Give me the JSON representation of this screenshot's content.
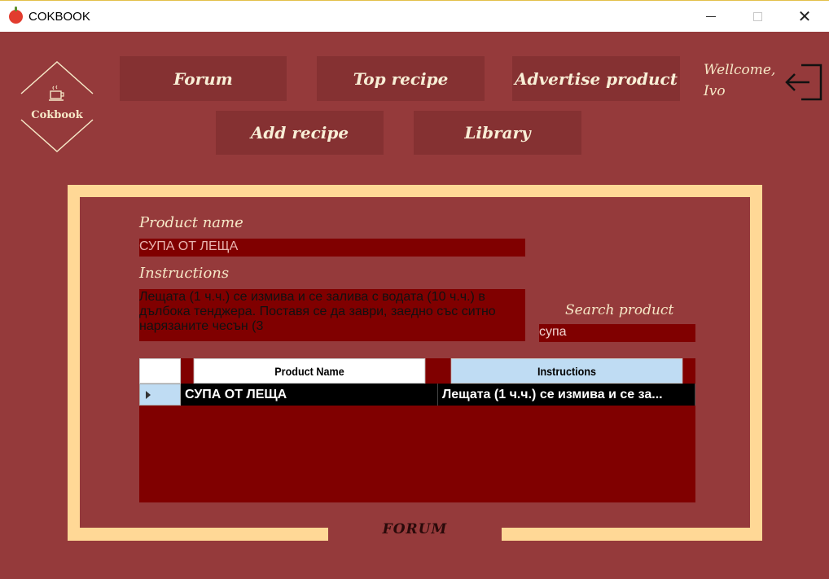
{
  "window": {
    "title": "COKBOOK",
    "minimize_icon": "minimize-icon",
    "maximize_icon": "maximize-icon",
    "close_icon": "close-icon"
  },
  "logo": {
    "text": "Cokbook",
    "icon": "coffee-cup-icon"
  },
  "nav": {
    "forum": "Forum",
    "top_recipe": "Top recipe",
    "advertise_product": "Advertise product",
    "add_recipe": "Add recipe",
    "library": "Library"
  },
  "user": {
    "greeting": "Wellcome,",
    "name": "Ivo",
    "logout_icon": "logout-icon"
  },
  "form": {
    "product_name_label": "Product name",
    "product_name_value": "СУПА ОТ ЛЕЩА",
    "instructions_label": "Instructions",
    "instructions_value": "Лещата (1 ч.ч.) се измива и се залива с водата (10 ч.ч.) в дълбока тенджера. Поставя се да заври, заедно със ситно нарязаните чесън (3",
    "search_label": "Search product",
    "search_value": "супа"
  },
  "table": {
    "columns": [
      "Product Name",
      "Instructions"
    ],
    "rows": [
      {
        "product_name": "СУПА ОТ ЛЕЩА",
        "instructions": "Лещата (1 ч.ч.) се измива и се за..."
      }
    ]
  },
  "page_caption": "FORUM",
  "colors": {
    "background": "#953a3b",
    "nav_button": "#853132",
    "frame": "#ffd896",
    "field": "#800000",
    "text_light": "#f6e8c7"
  }
}
